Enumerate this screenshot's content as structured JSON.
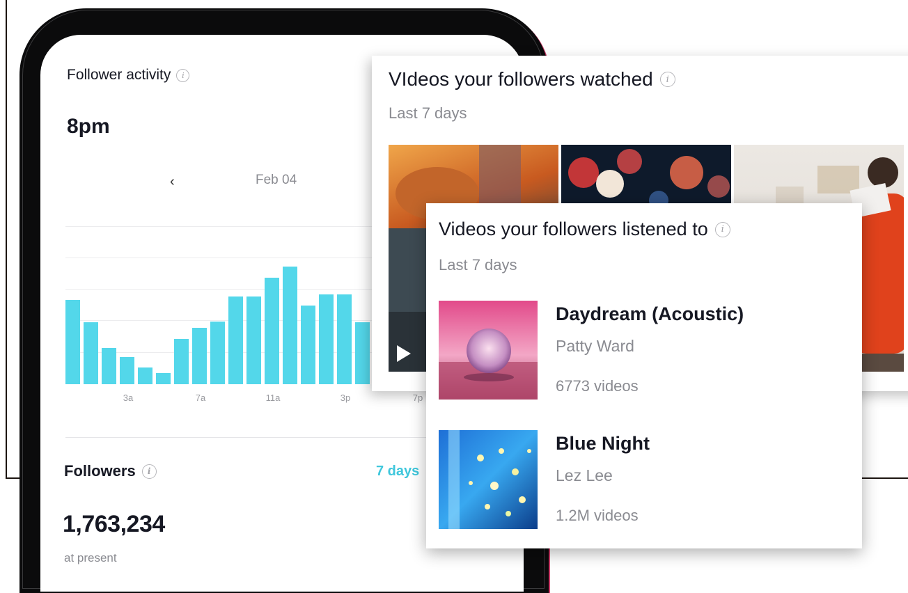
{
  "follower_activity": {
    "title": "Follower activity",
    "peak_time": "8pm",
    "prev_icon": "chevron-left-icon",
    "date": "Feb 04",
    "chart_data": {
      "type": "bar",
      "x_tick_labels": [
        "3a",
        "7a",
        "11a",
        "3p",
        "7p"
      ],
      "values": [
        75,
        55,
        32,
        24,
        15,
        10,
        40,
        50,
        56,
        78,
        78,
        95,
        105,
        70,
        80,
        80,
        55
      ],
      "ylim": [
        0,
        150
      ],
      "color": "#53d7ea"
    }
  },
  "followers": {
    "title": "Followers",
    "range_label": "7 days",
    "count": "1,763,234",
    "sub": "at present"
  },
  "videos_watched": {
    "title": "VIdeos your followers watched",
    "subtitle": "Last 7 days",
    "play_icon": "play-icon"
  },
  "videos_listened": {
    "title": "Videos your followers listened to",
    "subtitle": "Last 7 days",
    "songs": [
      {
        "title": "Daydream (Acoustic)",
        "artist": "Patty Ward",
        "count": "6773 videos"
      },
      {
        "title": "Blue Night",
        "artist": "Lez Lee",
        "count": "1.2M videos"
      }
    ]
  },
  "colors": {
    "accent": "#3fc7dc",
    "bar": "#53d7ea",
    "muted_text": "#8a8b91"
  }
}
